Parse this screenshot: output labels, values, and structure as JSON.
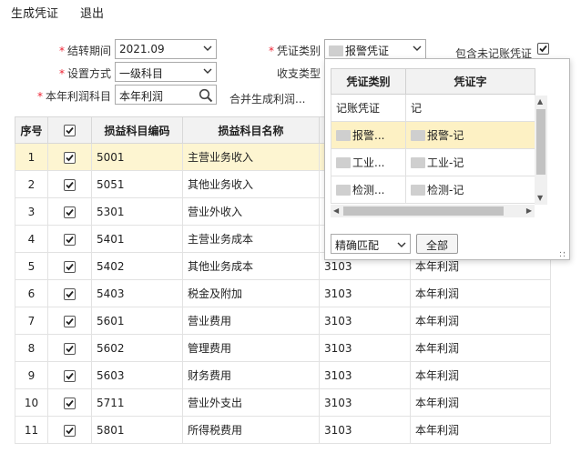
{
  "menu": {
    "generate_label": "生成凭证",
    "exit_label": "退出"
  },
  "form": {
    "period_label": "结转期间",
    "period_value": "2021.09",
    "mode_label": "设置方式",
    "mode_value": "一级科目",
    "profit_label": "本年利润科目",
    "profit_value": "本年利润",
    "voucher_type_label": "凭证类别",
    "voucher_type_value": "报警凭证",
    "include_label": "包含未记账凭证",
    "income_type_label": "收支类型",
    "merge_label": "合并生成利润..."
  },
  "grid": {
    "headers": [
      "序号",
      "",
      "损益科目编码",
      "损益科目名称",
      "",
      ""
    ],
    "rows": [
      {
        "no": "1",
        "code": "5001",
        "name": "主营业务收入",
        "pcode": "",
        "pname": ""
      },
      {
        "no": "2",
        "code": "5051",
        "name": "其他业务收入",
        "pcode": "",
        "pname": ""
      },
      {
        "no": "3",
        "code": "5301",
        "name": "营业外收入",
        "pcode": "",
        "pname": ""
      },
      {
        "no": "4",
        "code": "5401",
        "name": "主营业务成本",
        "pcode": "",
        "pname": ""
      },
      {
        "no": "5",
        "code": "5402",
        "name": "其他业务成本",
        "pcode": "3103",
        "pname": "本年利润"
      },
      {
        "no": "6",
        "code": "5403",
        "name": "税金及附加",
        "pcode": "3103",
        "pname": "本年利润"
      },
      {
        "no": "7",
        "code": "5601",
        "name": "营业费用",
        "pcode": "3103",
        "pname": "本年利润"
      },
      {
        "no": "8",
        "code": "5602",
        "name": "管理费用",
        "pcode": "3103",
        "pname": "本年利润"
      },
      {
        "no": "9",
        "code": "5603",
        "name": "财务费用",
        "pcode": "3103",
        "pname": "本年利润"
      },
      {
        "no": "10",
        "code": "5711",
        "name": "营业外支出",
        "pcode": "3103",
        "pname": "本年利润"
      },
      {
        "no": "11",
        "code": "5801",
        "name": "所得税费用",
        "pcode": "3103",
        "pname": "本年利润"
      }
    ]
  },
  "popup": {
    "headers": [
      "凭证类别",
      "凭证字"
    ],
    "rows": [
      {
        "type": "记账凭证",
        "word": "记"
      },
      {
        "type": "报警...",
        "word": "报警-记"
      },
      {
        "type": "工业...",
        "word": "工业-记"
      },
      {
        "type": "检测...",
        "word": "检测-记"
      }
    ],
    "match_value": "精确匹配",
    "all_label": "全部"
  },
  "colors": {
    "selected_row": "#fdf5d1",
    "header_bg": "#f2f2f2",
    "required_star": "#e23"
  }
}
